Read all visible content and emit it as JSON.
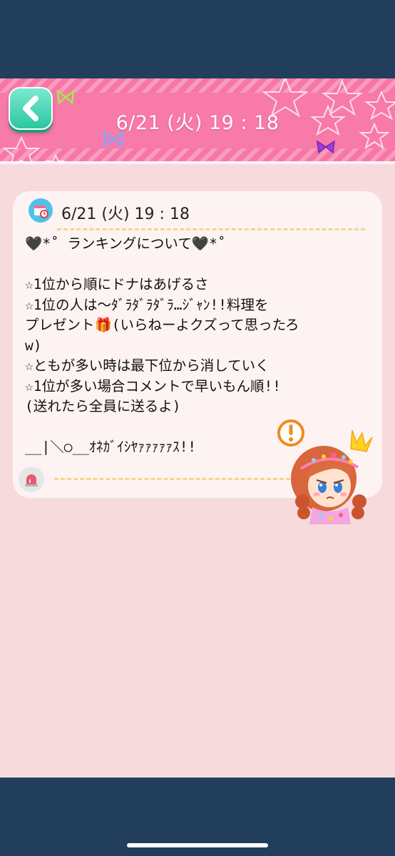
{
  "header": {
    "title": "6/21 (火) 19 : 18",
    "back_icon": "chevron-left-icon",
    "colors": {
      "header_pink": "#f776a6",
      "back_button": "#2dc6a1",
      "frame": "#213f5c",
      "background": "#f7dadc"
    }
  },
  "post": {
    "date": "6/21 (火) 19 : 18",
    "date_icon": "calendar-icon",
    "lines": [
      "🖤*˚ ランキングについて🖤*˚",
      "",
      "☆1位から順にドナはあげるさ",
      "☆1位の人は〜ﾀﾞﾗﾀﾞﾗﾀﾞﾗ…ｼﾞｬﾝ!!料理を",
      "プレゼント🎁(いらねーよクズって思ったろ",
      "w)",
      "☆ともが多い時は最下位から消していく",
      "☆1位が多い場合コメントで早いもん順!!",
      "(送れたら全員に送るよ)",
      "",
      "__|＼○__ｵﾈｶﾞｲｼﾔｧｧｧｧｧｽ!!"
    ],
    "report_icon": "siren-icon"
  },
  "avatar": {
    "badge_icon": "exclamation-icon"
  }
}
